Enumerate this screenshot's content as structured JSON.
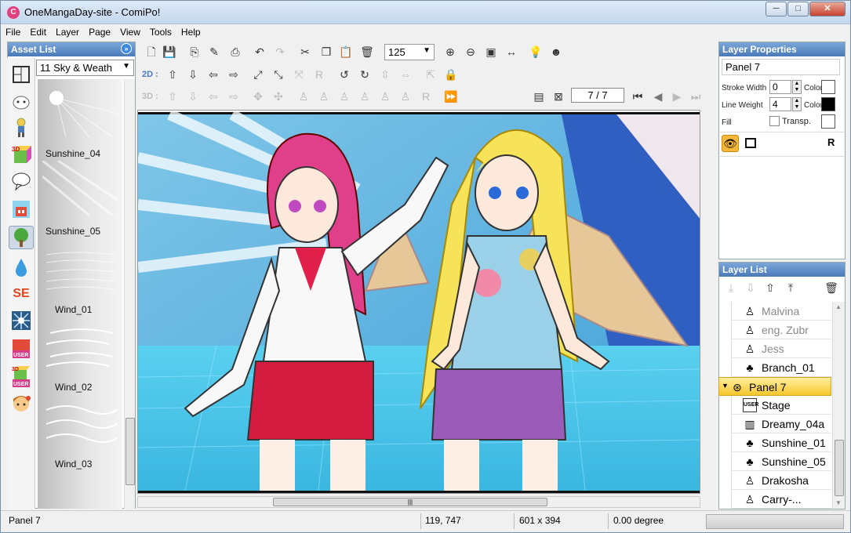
{
  "window": {
    "title": "OneMangaDay-site - ComiPo!",
    "app_icon": "comipo-icon"
  },
  "menu": [
    "File",
    "Edit",
    "Layer",
    "Page",
    "View",
    "Tools",
    "Help"
  ],
  "asset_list": {
    "header": "Asset List",
    "dropdown_value": "11 Sky & Weath",
    "items": [
      {
        "label": "Sunshine_04"
      },
      {
        "label": "Sunshine_05"
      },
      {
        "label": "Wind_01"
      },
      {
        "label": "Wind_02"
      },
      {
        "label": "Wind_03"
      }
    ],
    "categories": [
      "panel-layout-icon",
      "face-icon",
      "character-icon",
      "3d-object-icon",
      "speech-balloon-icon",
      "background-icon",
      "tree-icon",
      "drop-icon",
      "sound-effect-icon",
      "effect-icon",
      "user-background-icon",
      "user-3d-icon",
      "user-character-icon"
    ],
    "se_text": "SE",
    "user_text": "USER",
    "threed_text": "3D"
  },
  "toolbar": {
    "zoom": "125",
    "mode_2d": "2D :",
    "mode_3d": "3D :",
    "page": "7 / 7"
  },
  "layer_properties": {
    "header": "Layer Properties",
    "name": "Panel 7",
    "stroke_width_label": "Stroke Width",
    "stroke_width": "0",
    "line_weight_label": "Line Weight",
    "line_weight": "4",
    "color_label": "Color",
    "fill_label": "Fill",
    "transp_label": "Transp.",
    "stroke_color": "#ffffff",
    "line_color": "#000000"
  },
  "layer_list": {
    "header": "Layer List",
    "rows": [
      {
        "name": "Malvina",
        "icon": "character-icon",
        "dim": true
      },
      {
        "name": "eng. Zubr",
        "icon": "character-icon",
        "dim": true
      },
      {
        "name": "Jess",
        "icon": "character-icon",
        "dim": true
      },
      {
        "name": "Branch_01",
        "icon": "tree-icon",
        "dim": false
      },
      {
        "name": "Panel 7",
        "icon": "panel-icon",
        "dim": false,
        "selected": true
      },
      {
        "name": "Stage",
        "icon": "user-background-icon",
        "dim": false
      },
      {
        "name": "Dreamy_04a",
        "icon": "background-icon",
        "dim": false
      },
      {
        "name": "Sunshine_01",
        "icon": "tree-icon",
        "dim": false
      },
      {
        "name": "Sunshine_05",
        "icon": "tree-icon",
        "dim": false
      },
      {
        "name": "Drakosha",
        "icon": "character-icon",
        "dim": false
      },
      {
        "name": "Carry-...",
        "icon": "character-icon",
        "dim": false
      }
    ],
    "user_text": "USER"
  },
  "status": {
    "layer": "Panel 7",
    "coords": "119, 747",
    "size": "601 x 394",
    "angle": "0.00 degree"
  }
}
